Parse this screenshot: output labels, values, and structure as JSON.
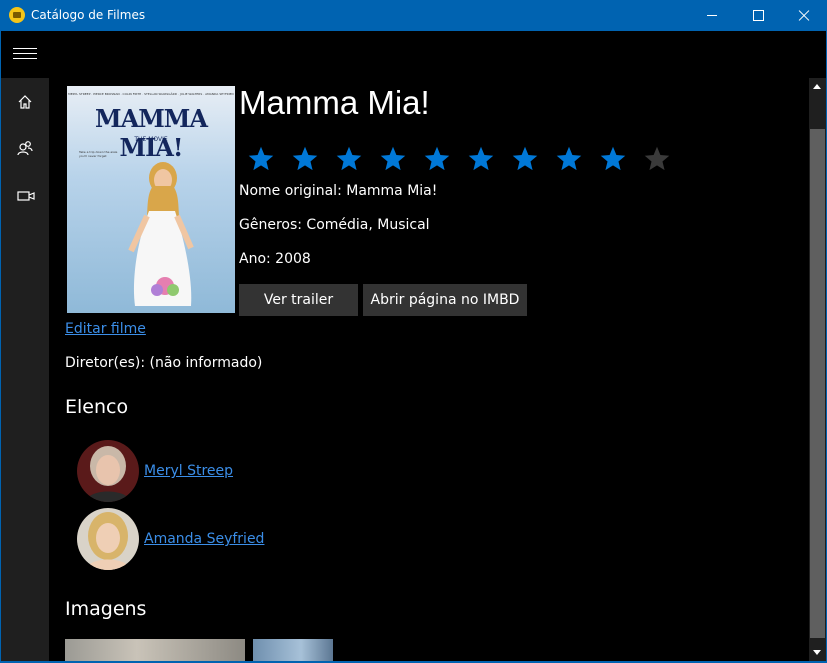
{
  "window": {
    "title": "Catálogo de Filmes"
  },
  "movie": {
    "title": "Mamma Mia!",
    "rating": 9,
    "rating_max": 10,
    "original_name": "Nome original: Mamma Mia!",
    "genres": "Gêneros: Comédia, Musical",
    "year": "Ano: 2008",
    "trailer_label": "Ver trailer",
    "imdb_label": "Abrir página no IMBD",
    "edit_label": "Editar filme",
    "director": "Diretor(es): (não informado)",
    "poster": {
      "title": "MAMMA MIA!",
      "subtitle": "THE MOVIE"
    }
  },
  "cast": {
    "heading": "Elenco",
    "members": [
      {
        "name": "Meryl Streep"
      },
      {
        "name": "Amanda Seyfried"
      }
    ]
  },
  "images": {
    "heading": "Imagens"
  },
  "colors": {
    "accent": "#0063b1",
    "star_on": "#0078d7",
    "star_off": "#3a3a3a",
    "link": "#3b8ee8"
  },
  "icons": {
    "menu": "hamburger-icon",
    "nav": [
      "home-icon",
      "people-icon",
      "video-icon"
    ]
  }
}
